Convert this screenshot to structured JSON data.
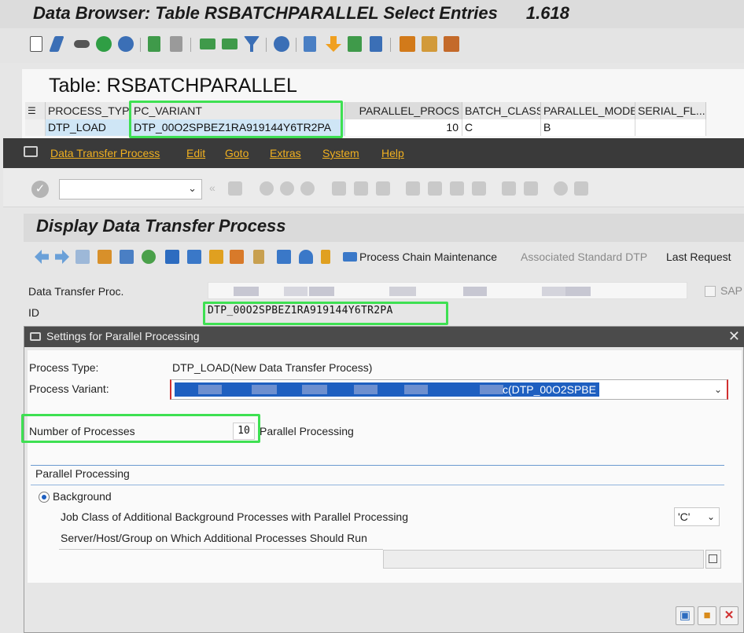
{
  "data_browser": {
    "title": "Data Browser: Table RSBATCHPARALLEL Select Entries",
    "entry_count": "1.618",
    "table_title": "Table: RSBATCHPARALLEL",
    "columns": [
      "PROCESS_TYPE",
      "PC_VARIANT",
      "PARALLEL_PROCS",
      "BATCH_CLASS",
      "PARALLEL_MODE",
      "SERIAL_FL..."
    ],
    "row": {
      "process_type": "DTP_LOAD",
      "pc_variant": "DTP_00O2SPBEZ1RA919144Y6TR2PA",
      "parallel_procs": "10",
      "batch_class": "C",
      "parallel_mode": "B",
      "serial_fl": ""
    }
  },
  "dtp_window": {
    "menu": [
      "Data Transfer Process",
      "Edit",
      "Goto",
      "Extras",
      "System",
      "Help"
    ],
    "title": "Display Data Transfer Process",
    "toolbar_buttons": {
      "process_chain_maintenance": "Process Chain Maintenance",
      "associated_standard_dtp": "Associated Standard DTP",
      "last_request": "Last Request"
    },
    "fields": {
      "dtp_label": "Data Transfer Proc.",
      "id_label": "ID",
      "id_value": "DTP_00O2SPBEZ1RA919144Y6TR2PA",
      "sap_checkbox_label": "SAP"
    }
  },
  "dialog": {
    "title": "Settings for Parallel Processing",
    "process_type_label": "Process Type:",
    "process_type_value": "DTP_LOAD(New Data Transfer Process)",
    "process_variant_label": "Process Variant:",
    "process_variant_value": "c(DTP_00O2SPBE",
    "number_of_processes_label": "Number of Processes",
    "number_of_processes_value": "10",
    "parallel_processing_suffix": "Parallel Processing",
    "group_title": "Parallel Processing",
    "background_label": "Background",
    "job_class_label": "Job Class of Additional Background Processes with Parallel Processing",
    "job_class_value": "'C'",
    "server_label": "Server/Host/Group on Which Additional Processes Should Run",
    "server_value": ""
  },
  "colors": {
    "highlight": "#3ee052",
    "menu_text": "#f0b020",
    "selection_blue": "#1e5fc0"
  }
}
